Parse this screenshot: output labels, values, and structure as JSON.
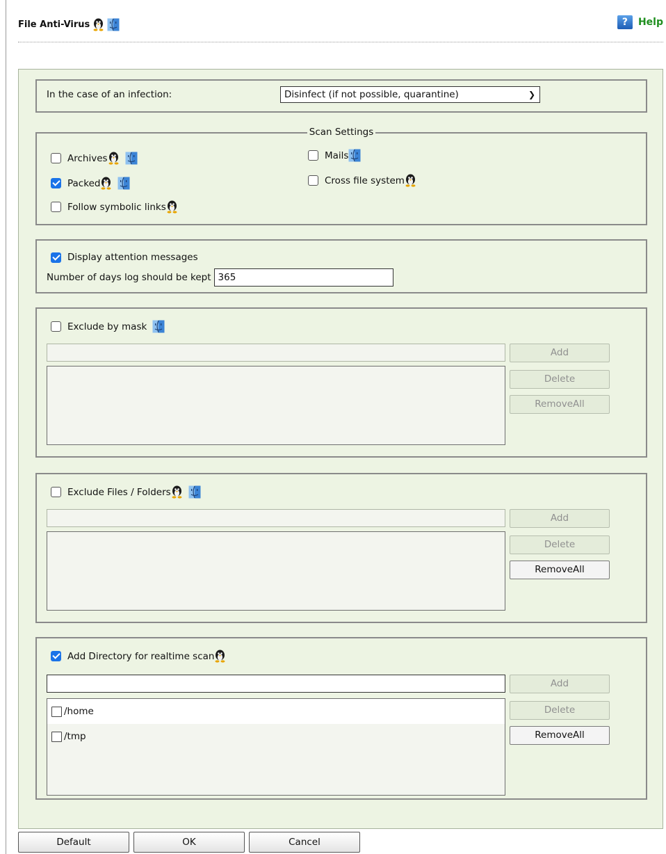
{
  "header": {
    "title": "File Anti-Virus",
    "help_label": "Help",
    "help_icon_glyph": "?"
  },
  "infection": {
    "label": "In the case of an infection:",
    "selected": "Disinfect (if not possible, quarantine)"
  },
  "scan_settings": {
    "legend": "Scan Settings",
    "archives": {
      "label": "Archives",
      "checked": false
    },
    "mails": {
      "label": "Mails",
      "checked": false
    },
    "packed": {
      "label": "Packed",
      "checked": true
    },
    "cross_fs": {
      "label": "Cross file system",
      "checked": false
    },
    "symlinks": {
      "label": "Follow symbolic links",
      "checked": false
    }
  },
  "attention": {
    "display_label": "Display attention messages",
    "display_checked": true,
    "days_label": "Number of days log should be kept",
    "days_value": "365"
  },
  "exclude_mask": {
    "label": "Exclude by mask",
    "checked": false,
    "add": "Add",
    "delete": "Delete",
    "remove_all": "RemoveAll"
  },
  "exclude_files": {
    "label": "Exclude Files / Folders",
    "checked": false,
    "add": "Add",
    "delete": "Delete",
    "remove_all": "RemoveAll"
  },
  "realtime": {
    "label": "Add Directory for realtime scan",
    "checked": true,
    "add": "Add",
    "delete": "Delete",
    "remove_all": "RemoveAll",
    "items": [
      {
        "path": "/home",
        "checked": false
      },
      {
        "path": "/tmp",
        "checked": false
      }
    ]
  },
  "footer": {
    "default": "Default",
    "ok": "OK",
    "cancel": "Cancel"
  },
  "colors": {
    "panel_bg": "#edf4e3",
    "checkbox_accent": "#1a73e8",
    "help_green": "#1f8f1f"
  }
}
